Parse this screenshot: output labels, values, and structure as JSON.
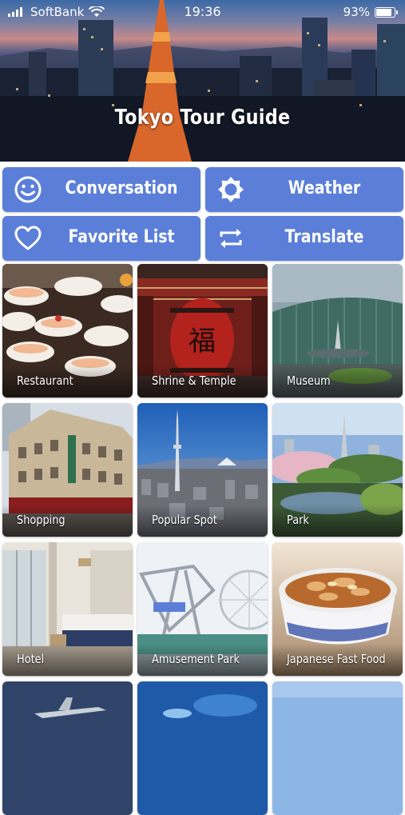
{
  "status_bar": {
    "carrier": "SoftBank",
    "time": "19:36",
    "battery": "93%",
    "battery_level": 0.93
  },
  "header": {
    "title": "Tokyo Tour Guide"
  },
  "menu": [
    {
      "label": "Conversation",
      "icon": "smiley-icon"
    },
    {
      "label": "Weather",
      "icon": "sun-icon"
    },
    {
      "label": "Favorite List",
      "icon": "heart-icon"
    },
    {
      "label": "Translate",
      "icon": "repeat-arrows-icon"
    }
  ],
  "categories": [
    {
      "label": "Restaurant"
    },
    {
      "label": "Shrine & Temple"
    },
    {
      "label": "Museum"
    },
    {
      "label": "Shopping"
    },
    {
      "label": "Popular Spot"
    },
    {
      "label": "Park"
    },
    {
      "label": "Hotel"
    },
    {
      "label": "Amusement Park"
    },
    {
      "label": "Japanese Fast Food"
    }
  ],
  "colors": {
    "accent": "#5b7fd9"
  }
}
